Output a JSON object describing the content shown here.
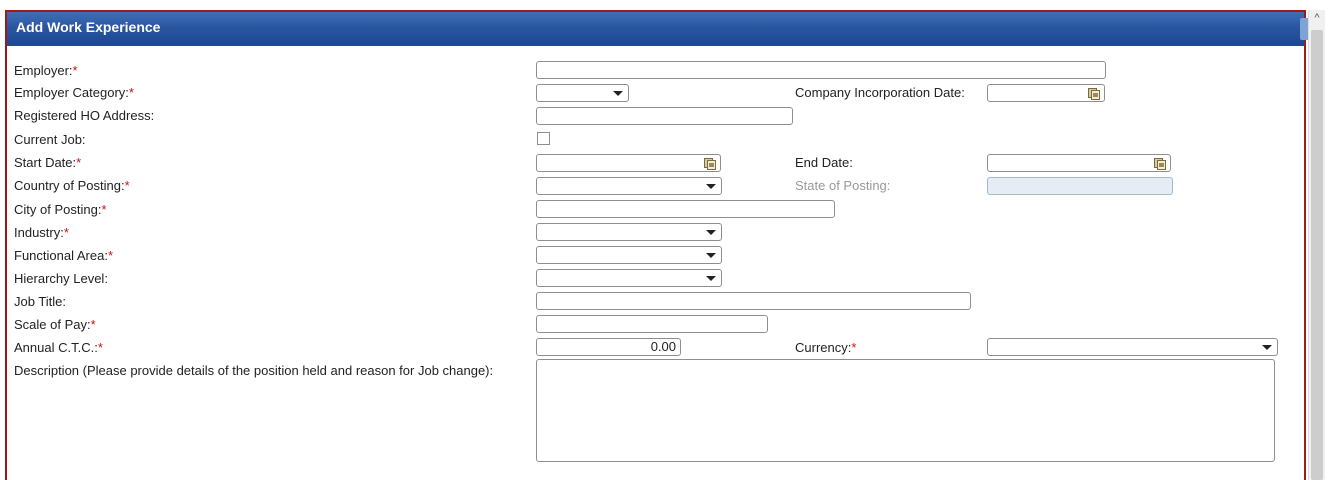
{
  "panel": {
    "title": "Add Work Experience"
  },
  "required_marker": "*",
  "fields": {
    "employer": {
      "label": "Employer:",
      "value": ""
    },
    "employer_category": {
      "label": "Employer Category:",
      "value": ""
    },
    "company_incorporation_date": {
      "label": "Company Incorporation Date:",
      "value": ""
    },
    "registered_ho_address": {
      "label": "Registered HO Address:",
      "value": ""
    },
    "current_job": {
      "label": "Current Job:",
      "checked": false
    },
    "start_date": {
      "label": "Start Date:",
      "value": ""
    },
    "end_date": {
      "label": "End Date:",
      "value": ""
    },
    "country_of_posting": {
      "label": "Country of Posting:",
      "value": ""
    },
    "state_of_posting": {
      "label": "State of Posting:",
      "value": ""
    },
    "city_of_posting": {
      "label": "City of Posting:",
      "value": ""
    },
    "industry": {
      "label": "Industry:",
      "value": ""
    },
    "functional_area": {
      "label": "Functional Area:",
      "value": ""
    },
    "hierarchy_level": {
      "label": "Hierarchy Level:",
      "value": ""
    },
    "job_title": {
      "label": "Job Title:",
      "value": ""
    },
    "scale_of_pay": {
      "label": "Scale of Pay:",
      "value": ""
    },
    "annual_ctc": {
      "label": "Annual C.T.C.:",
      "value": "0.00"
    },
    "currency": {
      "label": "Currency:",
      "value": ""
    },
    "description": {
      "label": "Description (Please provide details of the position held and reason for Job change):",
      "value": ""
    }
  },
  "colors": {
    "header_blue": "#2a56a0",
    "frame_red": "#a01818",
    "required_red": "#d01010"
  }
}
